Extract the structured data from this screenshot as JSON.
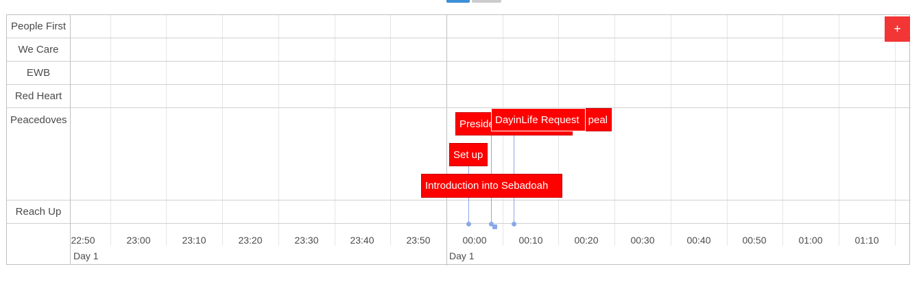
{
  "groups": [
    "People First",
    "We Care",
    "EWB",
    "Red Heart",
    "Peacedoves",
    "Reach Up"
  ],
  "time_ticks": [
    "22:50",
    "23:00",
    "23:10",
    "23:20",
    "23:30",
    "23:40",
    "23:50",
    "00:00",
    "00:10",
    "00:20",
    "00:30",
    "00:40",
    "00:50",
    "01:00",
    "01:10"
  ],
  "day_labels": [
    "Day 1",
    "Day 1"
  ],
  "items": [
    {
      "label": "Preside",
      "group": "Peacedoves"
    },
    {
      "label": "peal",
      "group": "Peacedoves"
    },
    {
      "label": "DayinLife Request",
      "group": "Peacedoves"
    },
    {
      "label": "Set up",
      "group": "Peacedoves"
    },
    {
      "label": "Introduction into Sebadoah",
      "group": "Peacedoves"
    }
  ],
  "add_button": {
    "label": "+"
  },
  "colors": {
    "item_bg": "#ff0000",
    "add_button_bg": "#f23535",
    "marker": "#8aa8e8",
    "active_tab": "#3a8fd6"
  }
}
